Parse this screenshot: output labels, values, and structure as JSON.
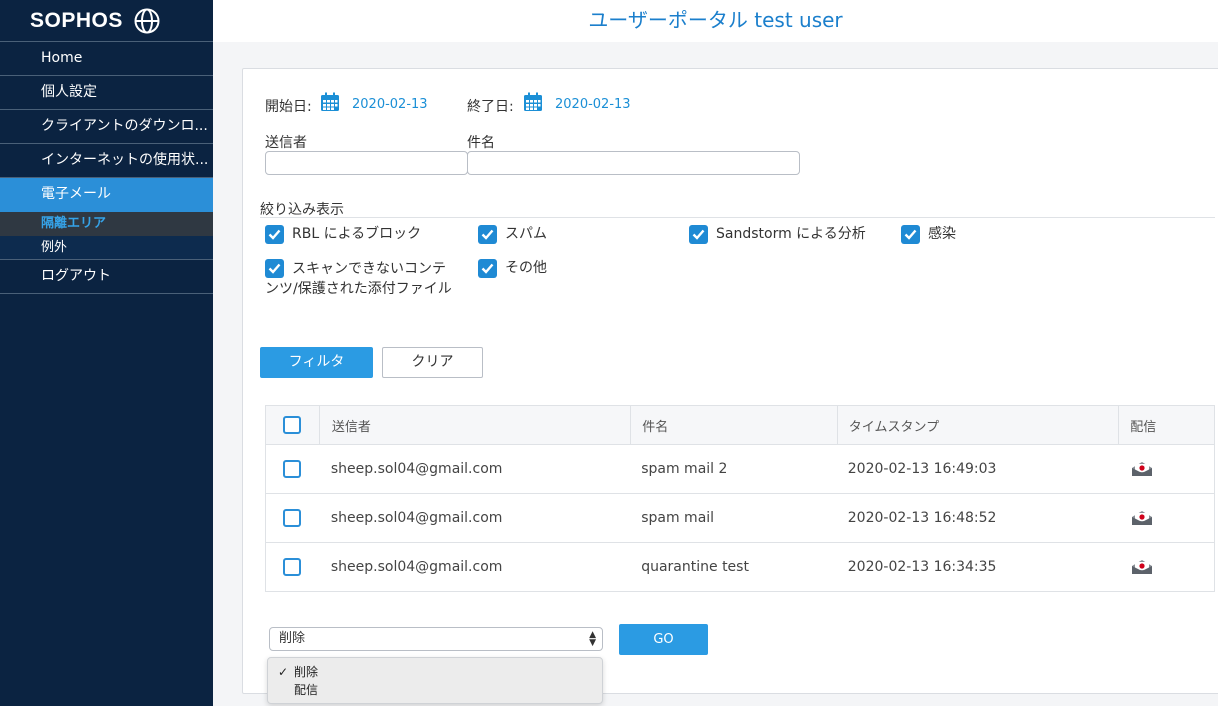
{
  "brand": {
    "name": "SOPHOS"
  },
  "header": {
    "title": "ユーザーポータル test user"
  },
  "sidebar": {
    "items": [
      {
        "label": "Home"
      },
      {
        "label": "個人設定"
      },
      {
        "label": "クライアントのダウンロ..."
      },
      {
        "label": "インターネットの使用状..."
      },
      {
        "label": "電子メール"
      }
    ],
    "subitems": [
      {
        "label": "隔離エリア"
      },
      {
        "label": "例外"
      }
    ],
    "logout": "ログアウト"
  },
  "filters": {
    "start_label": "開始日:",
    "start_date": "2020-02-13",
    "end_label": "終了日:",
    "end_date": "2020-02-13",
    "sender_label": "送信者",
    "sender_value": "",
    "subject_label": "件名",
    "subject_value": "",
    "refine_label": "絞り込み表示",
    "checkboxes": [
      {
        "label": "RBL によるブロック",
        "checked": true
      },
      {
        "label": "スパム",
        "checked": true
      },
      {
        "label": "Sandstorm による分析",
        "checked": true
      },
      {
        "label": "感染",
        "checked": true
      },
      {
        "label": "スキャンできないコンテンツ/保護された添付ファイル",
        "checked": true
      },
      {
        "label": "その他",
        "checked": true
      }
    ],
    "filter_button": "フィルタ",
    "clear_button": "クリア"
  },
  "table": {
    "columns": [
      "送信者",
      "件名",
      "タイムスタンプ",
      "配信"
    ],
    "rows": [
      {
        "sender": "sheep.sol04@gmail.com",
        "subject": "spam mail 2",
        "timestamp": "2020-02-13 16:49:03"
      },
      {
        "sender": "sheep.sol04@gmail.com",
        "subject": "spam mail",
        "timestamp": "2020-02-13 16:48:52"
      },
      {
        "sender": "sheep.sol04@gmail.com",
        "subject": "quarantine test",
        "timestamp": "2020-02-13 16:34:35"
      }
    ]
  },
  "actions": {
    "selected": "削除",
    "go_button": "GO",
    "options": [
      {
        "label": "削除",
        "checked": true
      },
      {
        "label": "配信",
        "checked": false
      }
    ],
    "check_mark": "✓"
  },
  "colors": {
    "sidebar_bg": "#0b2341",
    "accent": "#2b9be3",
    "title": "#1b7fcc",
    "active_sub": "#35a3e8"
  }
}
